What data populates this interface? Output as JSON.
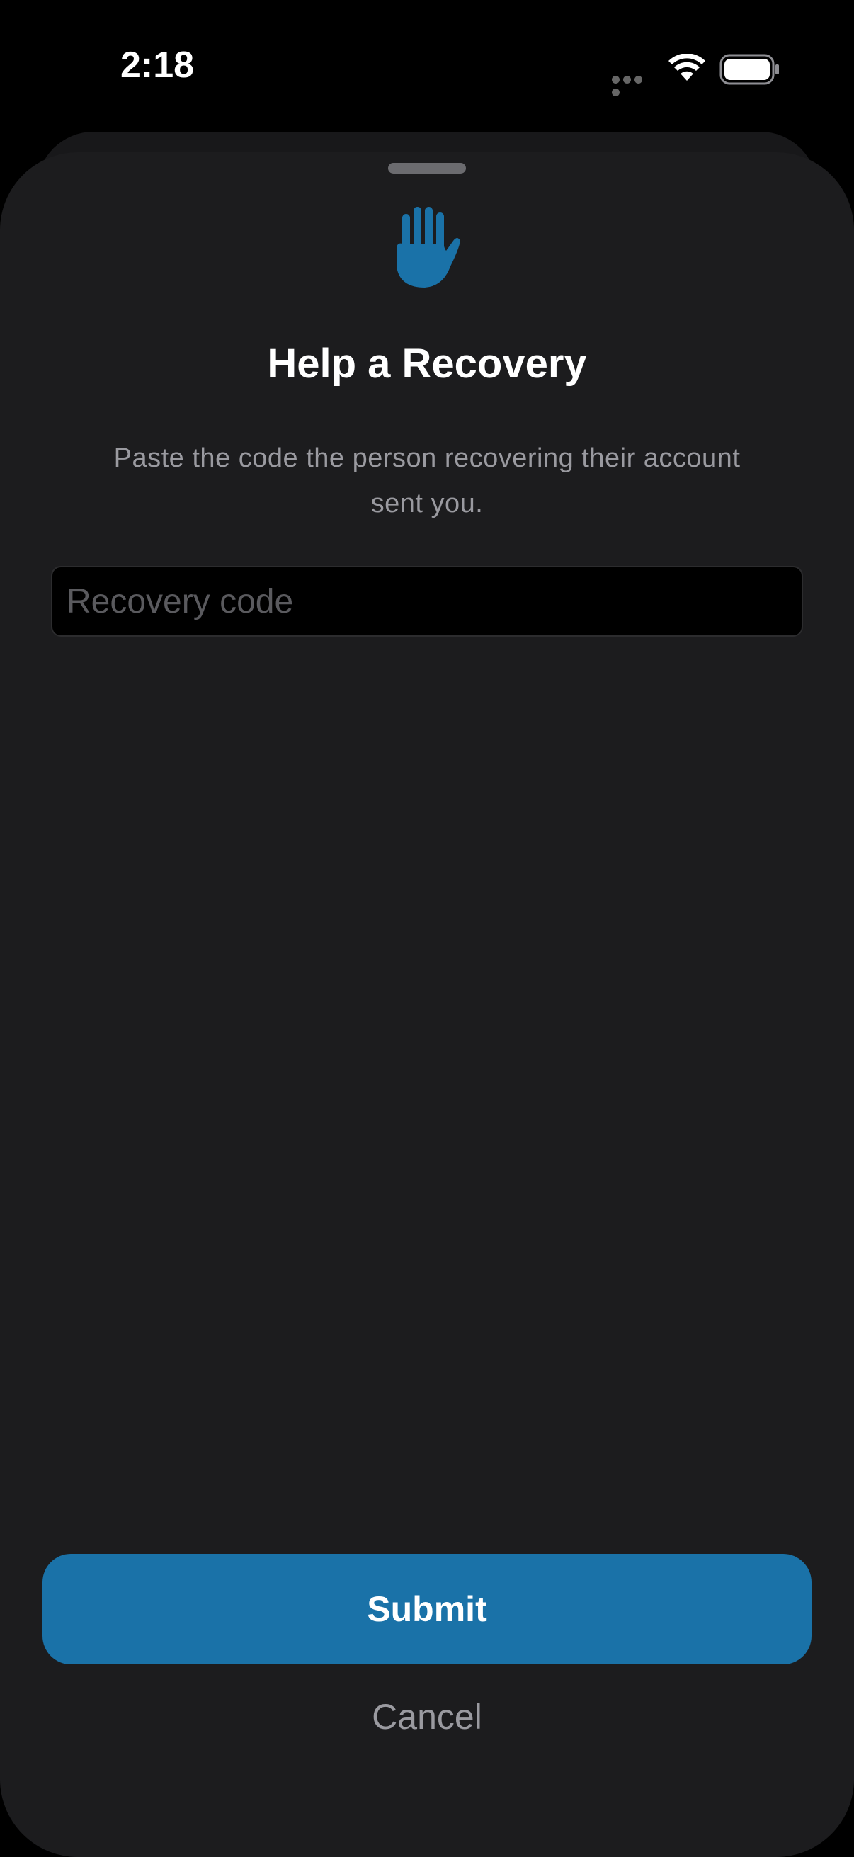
{
  "status_bar": {
    "time": "2:18",
    "icons": [
      "signal-dots-icon",
      "wifi-icon",
      "battery-icon"
    ]
  },
  "sheet": {
    "icon": "raised-hand-icon",
    "title": "Help a Recovery",
    "subtitle": "Paste the code the person recovering their account sent you.",
    "recovery_code": {
      "value": "",
      "placeholder": "Recovery code"
    },
    "submit_label": "Submit",
    "cancel_label": "Cancel"
  },
  "colors": {
    "accent": "#1a72a8",
    "sheet_background": "#1c1c1e",
    "background": "#000000"
  }
}
